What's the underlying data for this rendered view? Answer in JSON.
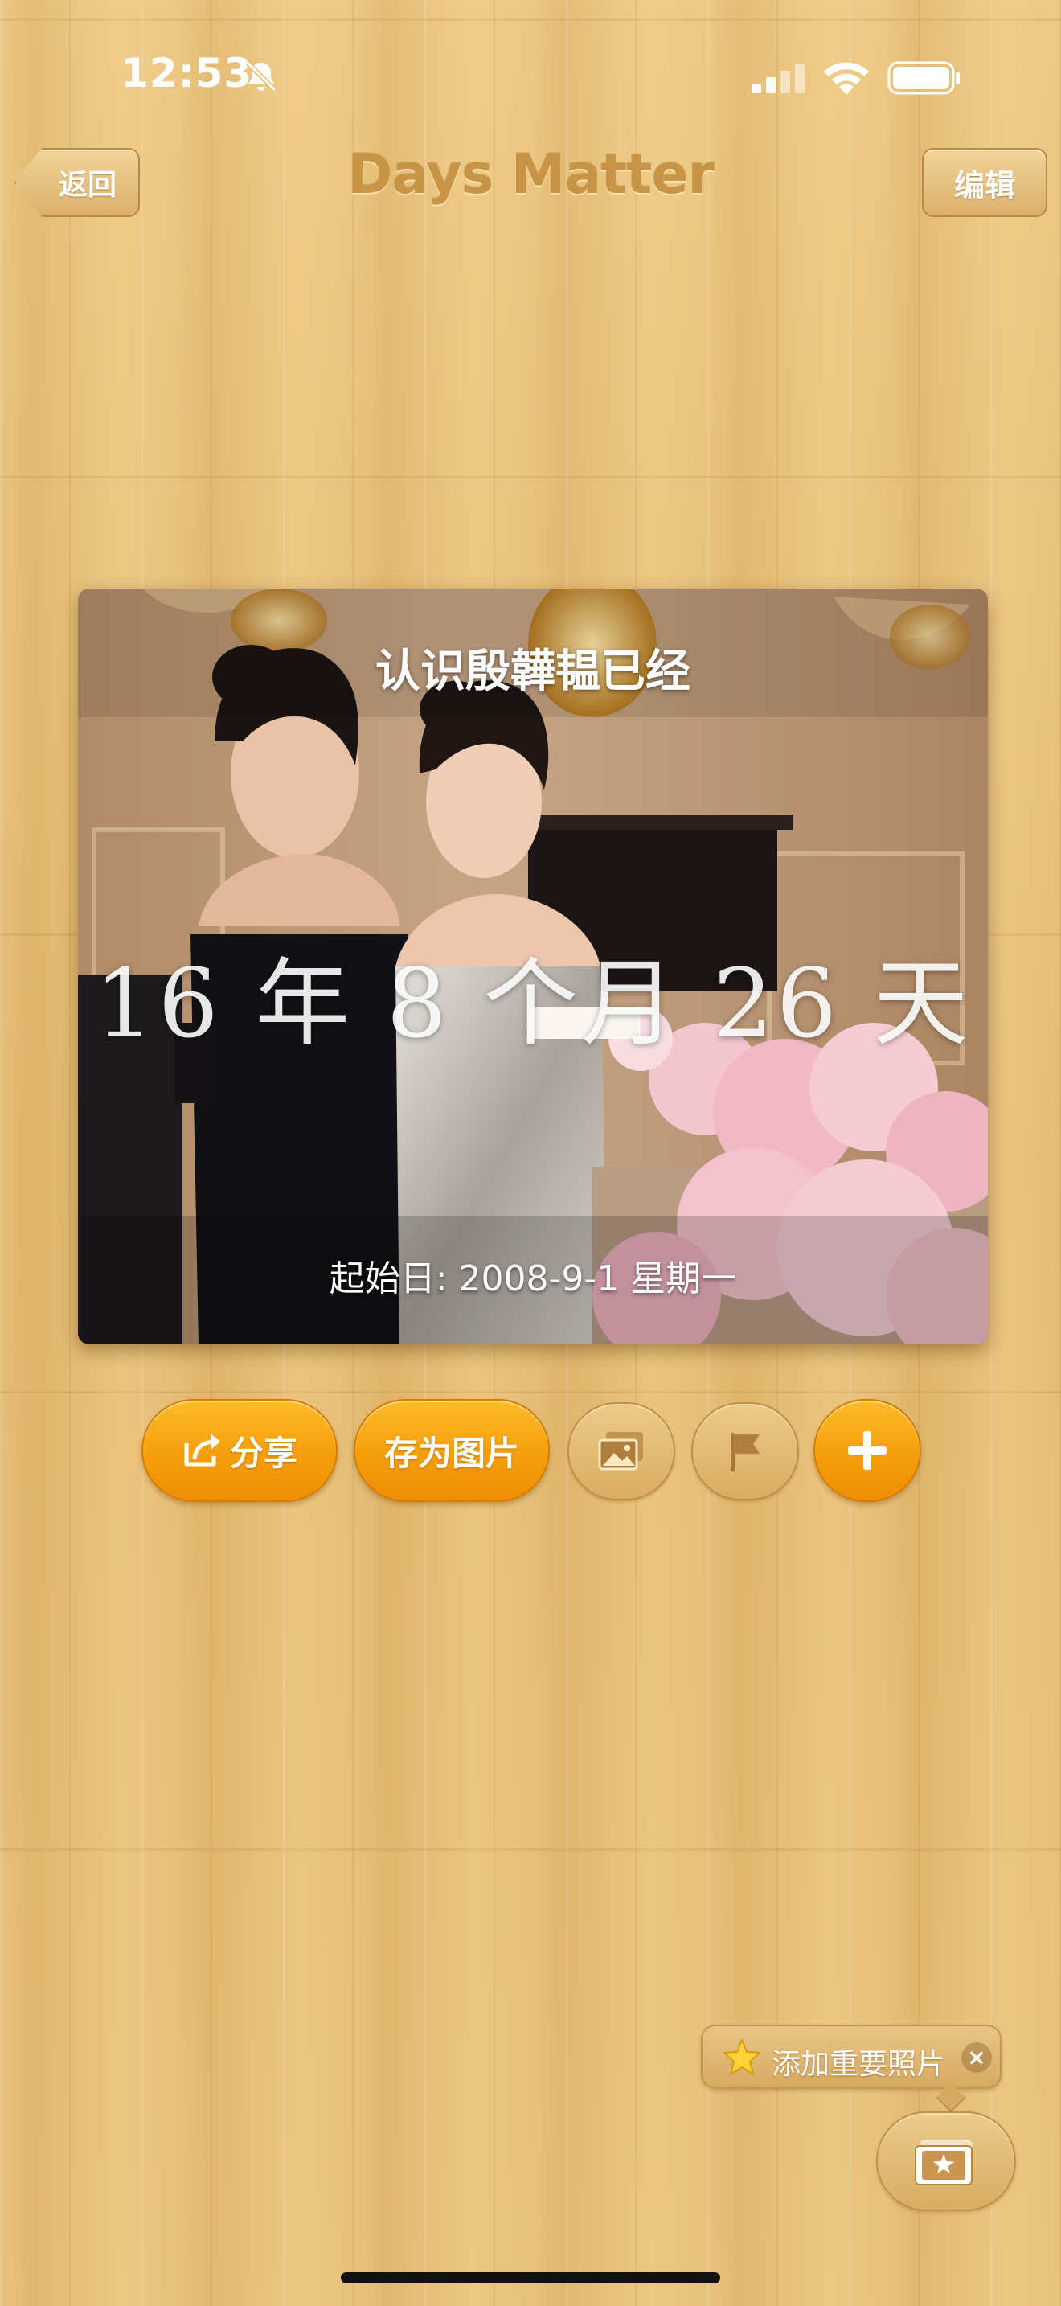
{
  "status_bar": {
    "time": "12:53",
    "icons": [
      "bell-slash-icon",
      "cellular-signal-icon",
      "wifi-icon",
      "battery-icon"
    ]
  },
  "nav": {
    "back_label": "返回",
    "title": "Days Matter",
    "edit_label": "编辑"
  },
  "card": {
    "title": "认识殷韡韫已经",
    "duration": "16 年 8 个月 26 天",
    "start_date": "起始日: 2008-9-1 星期一"
  },
  "actions": {
    "share_label": "分享",
    "save_image_label": "存为图片",
    "icons": [
      "share-icon",
      "photo-icon",
      "flag-icon",
      "plus-icon"
    ]
  },
  "tooltip": {
    "text": "添加重要照片",
    "close": "×",
    "icons": [
      "star-icon"
    ]
  },
  "gallery_icon": "photo-stack-star-icon",
  "colors": {
    "accent_orange": "#f59e0b",
    "wood": "#e6bf78",
    "title_brown": "#c89547"
  }
}
